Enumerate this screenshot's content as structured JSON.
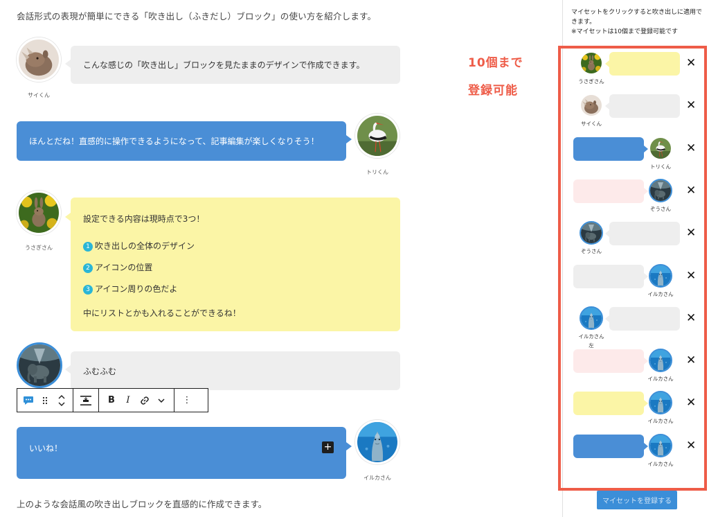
{
  "intro": "会話形式の表現が簡単にできる「吹き出し（ふきだし）ブロック」の使い方を紹介します。",
  "outro": "上のような会話風の吹き出しブロックを直感的に作成できます。",
  "conversation": {
    "sai_text": "こんな感じの「吹き出し」ブロックを見たままのデザインで作成できます。",
    "sai_name": "サイくん",
    "tori_text": "ほんとだね！直感的に操作できるようになって、記事編集が楽しくなりそう！",
    "tori_name": "トリくん",
    "usagi_name": "うさぎさん",
    "usagi_lines": {
      "intro": "設定できる内容は現時点で3つ！",
      "item1_num": "1",
      "item1": "吹き出しの全体のデザイン",
      "item2_num": "2",
      "item2": "アイコンの位置",
      "item3_num": "3",
      "item3": "アイコン周りの色だよ",
      "outro": "中にリストとかも入れることができるね！"
    },
    "zou_text": "ふむふむ",
    "iruka_text": "いいね！",
    "iruka_name": "イルカさん",
    "plus": "+"
  },
  "toolbar": {
    "bold": "B",
    "italic": "I",
    "more": "⋮"
  },
  "annotation": {
    "line1": "10個まで",
    "line2": "登録可能"
  },
  "sidebar": {
    "note_line1": "マイセットをクリックすると吹き出しに適用できます。",
    "note_line2": "※マイセットは10個まで登録可能です",
    "presets": [
      {
        "name": "うさぎさん",
        "color": "yellow",
        "side": "left"
      },
      {
        "name": "サイくん",
        "color": "gray",
        "side": "left"
      },
      {
        "name": "トリくん",
        "color": "blue",
        "side": "right"
      },
      {
        "name": "ぞうさん",
        "color": "pink",
        "side": "right"
      },
      {
        "name": "ぞうさん",
        "color": "gray",
        "side": "left"
      },
      {
        "name": "イルカさん",
        "color": "gray",
        "side": "right"
      },
      {
        "name": "イルカさん",
        "name2": "左",
        "color": "gray",
        "side": "left"
      },
      {
        "name": "イルカさん",
        "color": "pink",
        "side": "right"
      },
      {
        "name": "イルカさん",
        "color": "yellow",
        "side": "right"
      },
      {
        "name": "イルカさん",
        "color": "blue",
        "side": "right"
      }
    ],
    "close_glyph": "✕",
    "register_label": "マイセットを登録する"
  },
  "colors": {
    "accent_blue": "#4a8ed6",
    "bubble_gray": "#eeeeee",
    "bubble_yellow": "#fbf5a6",
    "bubble_pink": "#fdeaea",
    "annotation_red": "#ee5c48"
  }
}
